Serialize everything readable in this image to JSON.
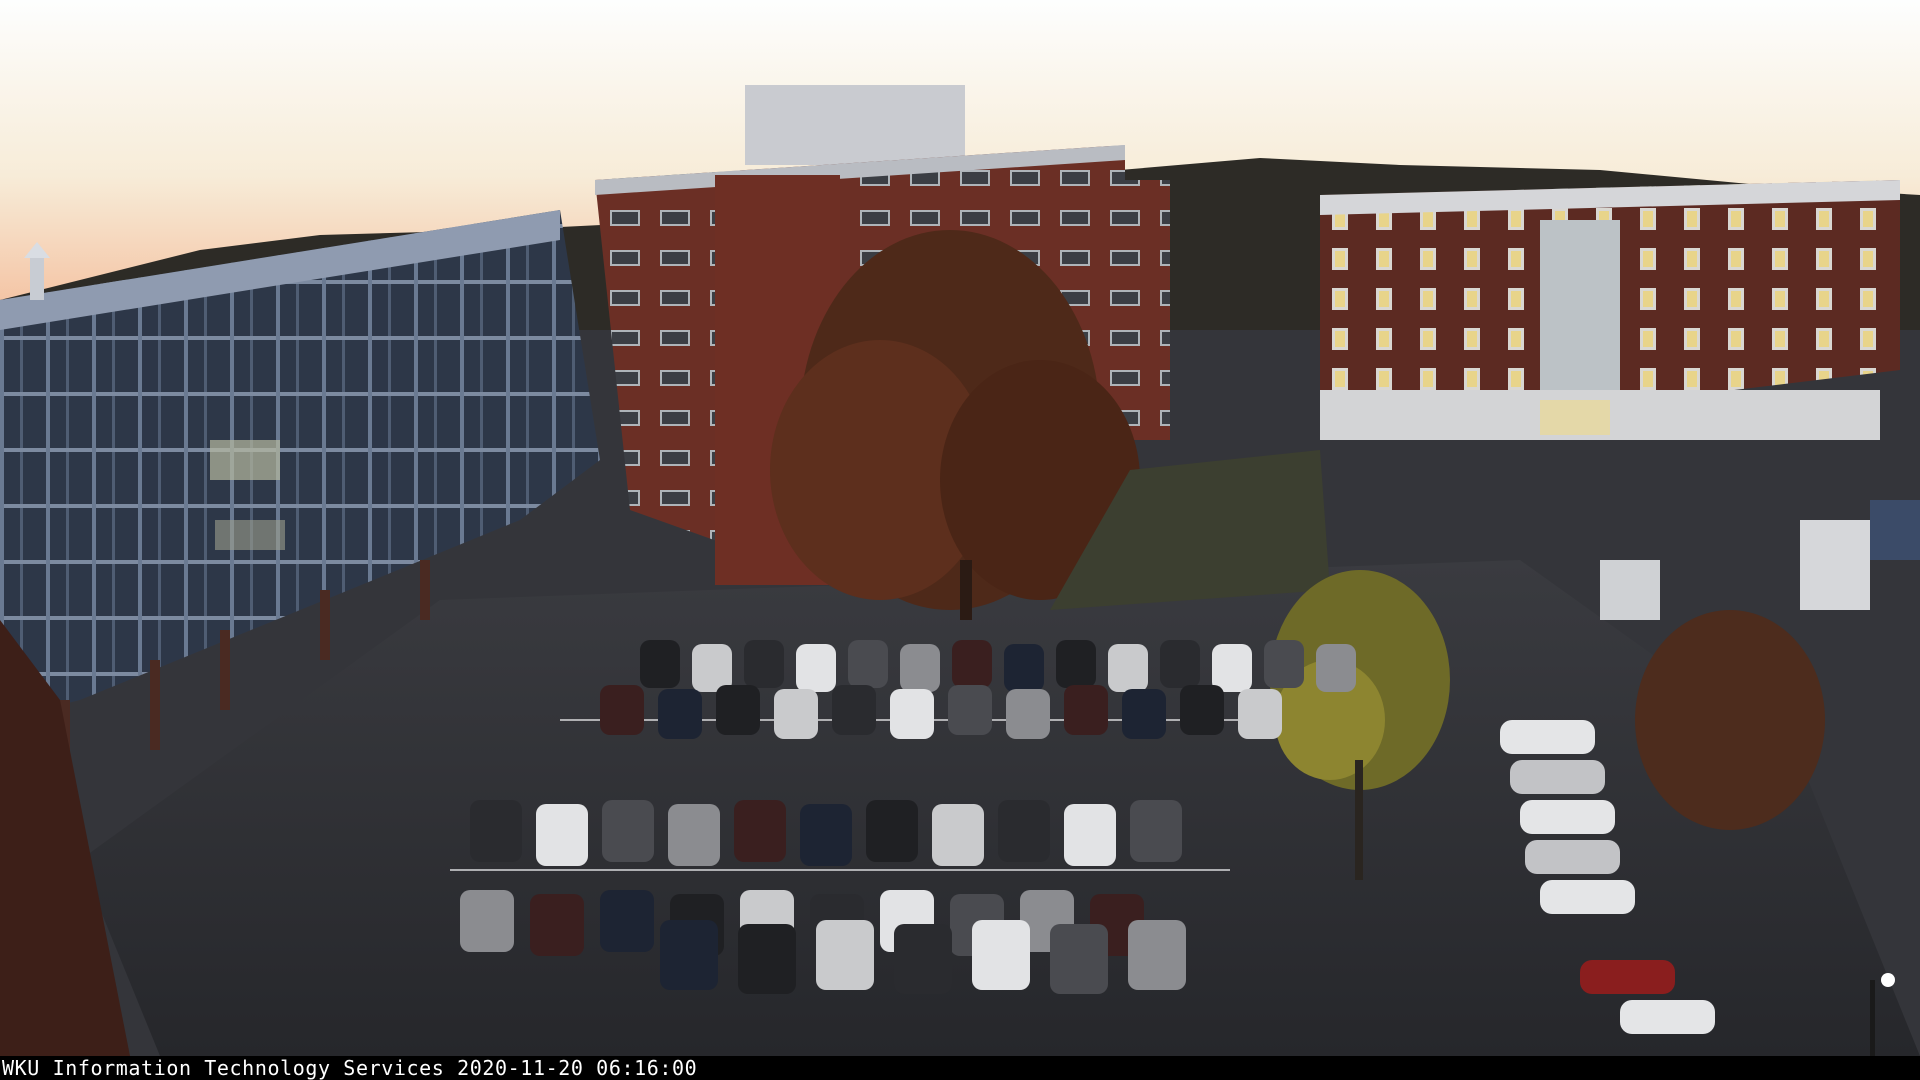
{
  "overlay": {
    "source": "WKU Information Technology Services",
    "date": "2020-11-20",
    "time": "06:16:00"
  },
  "scene_palette": {
    "sky_top": "#fbfdfc",
    "sky_horizon": "#f6c9a4",
    "brick": "#6a3128",
    "steel_frame": "#3f4a5e",
    "asphalt": "#2c2d31",
    "tree_autumn": "#5a2e1c"
  }
}
